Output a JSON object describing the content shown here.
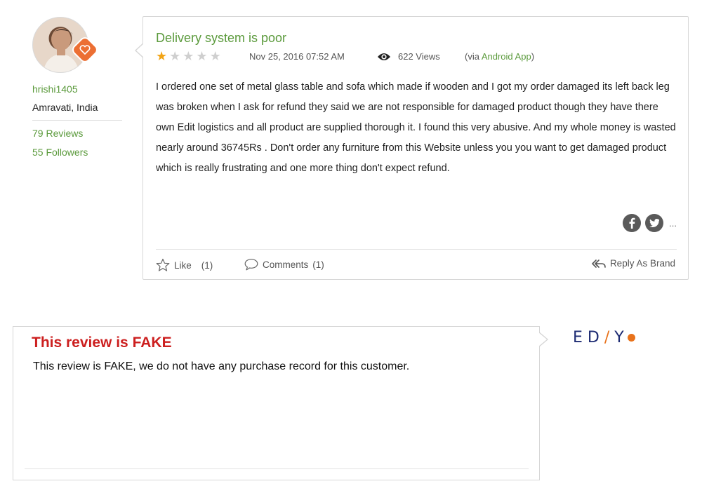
{
  "reviewer": {
    "username": "hrishi1405",
    "location": "Amravati, India",
    "reviews": "79 Reviews",
    "followers": "55 Followers"
  },
  "review": {
    "title": "Delivery system is poor",
    "rating": 1,
    "max_rating": 5,
    "date": "Nov 25, 2016 07:52 AM",
    "views": "622 Views",
    "via_prefix": "(via ",
    "via_app": "Android App",
    "via_suffix": ")",
    "body": "I ordered one set of metal glass table and sofa which made if wooden and I got my order damaged its left back leg was broken when I ask for refund they said we are not responsible for damaged product though they have there own Edit logistics and all product are supplied thorough it. I found this very abusive. And my whole money is wasted nearly around 36745Rs . Don't order any furniture from this Website unless you you want to get damaged product which is really frustrating and one more thing don't expect refund.",
    "more_label": "...",
    "like_label": "Like",
    "like_count": "(1)",
    "comments_label": "Comments",
    "comments_count": "(1)",
    "reply_label": "Reply As Brand"
  },
  "response": {
    "title": "This review is FAKE",
    "body": "This review is FAKE, we do not have any purchase record for this customer."
  },
  "brand": {
    "logo_text": "EDIY"
  },
  "colors": {
    "green": "#5b9a3c",
    "star": "#f2a416",
    "fake_red": "#cc1f1f",
    "brand_navy": "#1d2b73",
    "brand_orange": "#e8721b"
  }
}
